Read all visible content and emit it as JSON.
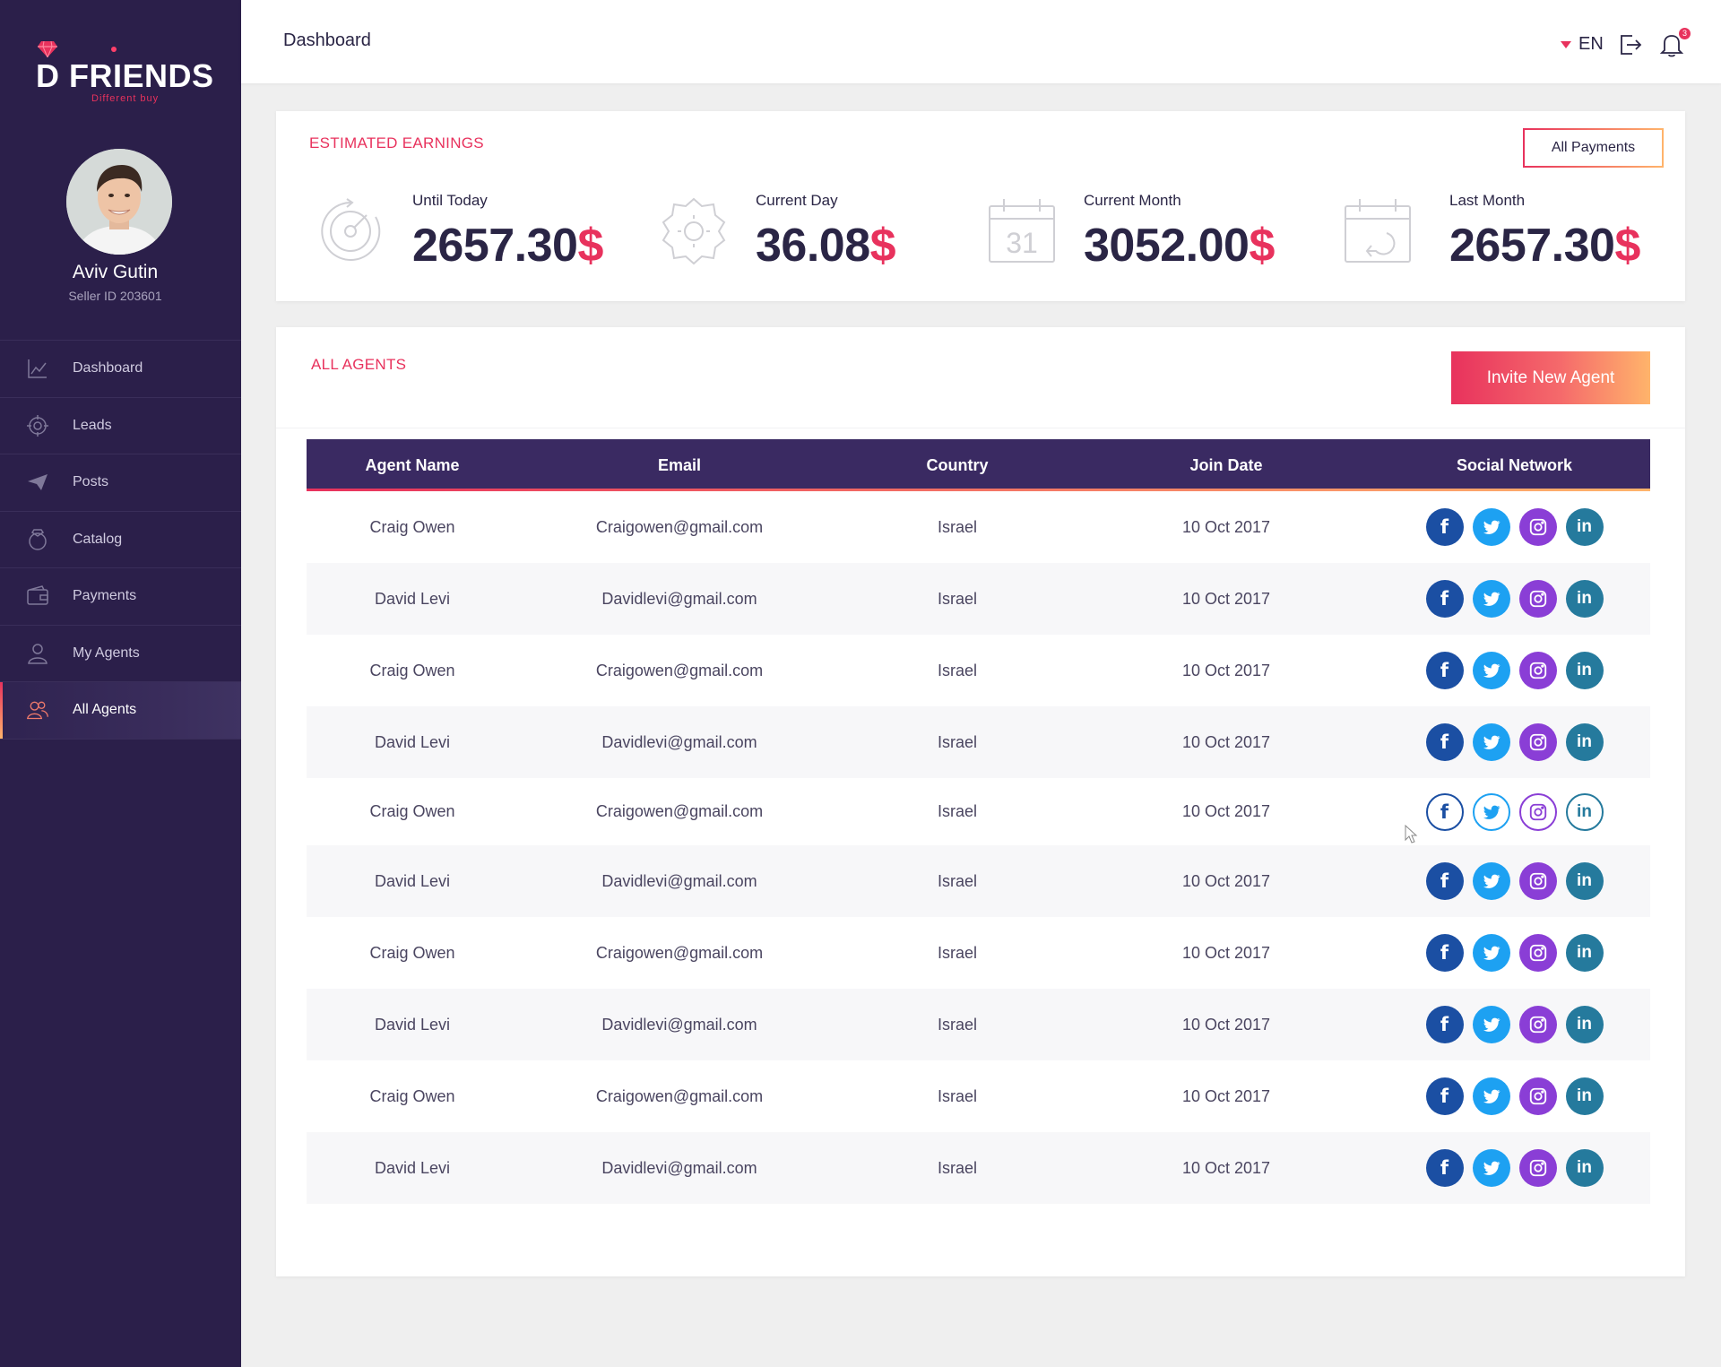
{
  "brand": {
    "name": "D FRIENDS",
    "tagline": "Different buy"
  },
  "user": {
    "name": "Aviv Gutin",
    "seller_id": "Seller ID 203601"
  },
  "sidebar": {
    "items": [
      {
        "label": "Dashboard",
        "icon": "chart-icon"
      },
      {
        "label": "Leads",
        "icon": "target-icon"
      },
      {
        "label": "Posts",
        "icon": "paper-plane-icon"
      },
      {
        "label": "Catalog",
        "icon": "ring-icon"
      },
      {
        "label": "Payments",
        "icon": "wallet-icon"
      },
      {
        "label": "My Agents",
        "icon": "user-icon"
      },
      {
        "label": "All Agents",
        "icon": "users-icon",
        "active": true
      }
    ]
  },
  "header": {
    "title": "Dashboard",
    "language": "EN",
    "notification_count": "3"
  },
  "earnings": {
    "title": "ESTIMATED EARNINGS",
    "button": "All Payments",
    "stats": [
      {
        "label": "Until Today",
        "value": "2657.30",
        "currency": "$",
        "icon": "gauge-icon"
      },
      {
        "label": "Current Day",
        "value": "36.08",
        "currency": "$",
        "icon": "sun-icon"
      },
      {
        "label": "Current Month",
        "value": "3052.00",
        "currency": "$",
        "icon": "calendar-31-icon"
      },
      {
        "label": "Last Month",
        "value": "2657.30",
        "currency": "$",
        "icon": "calendar-return-icon"
      }
    ]
  },
  "agents": {
    "title": "ALL AGENTS",
    "invite_button": "Invite New Agent",
    "columns": [
      "Agent Name",
      "Email",
      "Country",
      "Join Date",
      "Social Network"
    ],
    "rows": [
      [
        "Craig Owen",
        "Craigowen@gmail.com",
        "Israel",
        "10 Oct 2017"
      ],
      [
        "David Levi",
        "Davidlevi@gmail.com",
        "Israel",
        "10 Oct 2017"
      ],
      [
        "Craig Owen",
        "Craigowen@gmail.com",
        "Israel",
        "10 Oct 2017"
      ],
      [
        "David Levi",
        "Davidlevi@gmail.com",
        "Israel",
        "10 Oct 2017"
      ],
      [
        "Craig Owen",
        "Craigowen@gmail.com",
        "Israel",
        "10 Oct 2017"
      ],
      [
        "David Levi",
        "Davidlevi@gmail.com",
        "Israel",
        "10 Oct 2017"
      ],
      [
        "Craig Owen",
        "Craigowen@gmail.com",
        "Israel",
        "10 Oct 2017"
      ],
      [
        "David Levi",
        "Davidlevi@gmail.com",
        "Israel",
        "10 Oct 2017"
      ],
      [
        "Craig Owen",
        "Craigowen@gmail.com",
        "Israel",
        "10 Oct 2017"
      ],
      [
        "David Levi",
        "Davidlevi@gmail.com",
        "Israel",
        "10 Oct 2017"
      ]
    ],
    "social_networks": [
      "facebook-icon",
      "twitter-icon",
      "instagram-icon",
      "linkedin-icon"
    ],
    "hovered_row_index": 4
  },
  "colors": {
    "accent": "#e8325d",
    "accent_end": "#ffb46b",
    "sidebar": "#2b1f4a",
    "table_header": "#3a2a62"
  }
}
